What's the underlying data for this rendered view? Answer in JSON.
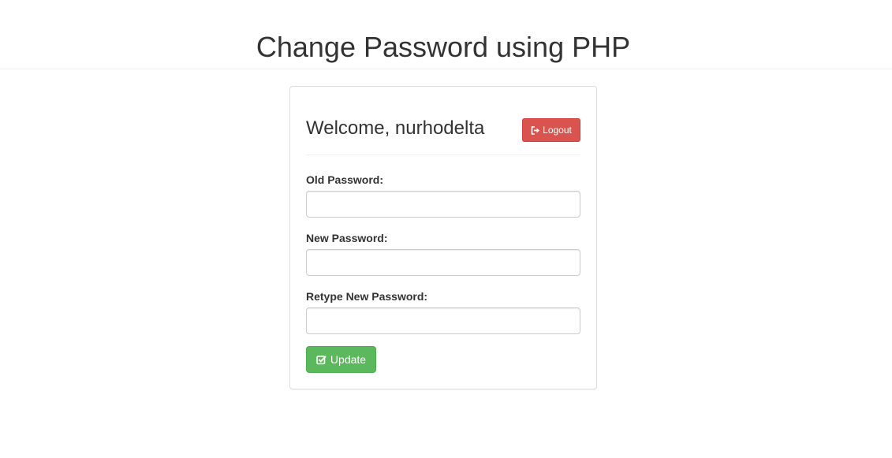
{
  "header": {
    "title": "Change Password using PHP"
  },
  "panel": {
    "welcome_prefix": "Welcome, ",
    "username": "nurhodelta",
    "logout_label": "Logout",
    "logout_icon": "sign-out-icon"
  },
  "form": {
    "old_password": {
      "label": "Old Password:",
      "value": "",
      "placeholder": ""
    },
    "new_password": {
      "label": "New Password:",
      "value": "",
      "placeholder": ""
    },
    "retype_password": {
      "label": "Retype New Password:",
      "value": "",
      "placeholder": ""
    },
    "update_label": "Update",
    "update_icon": "check-square-icon"
  },
  "colors": {
    "danger": "#d9534f",
    "success": "#5cb85c",
    "text": "#333333",
    "border": "#dddddd"
  }
}
